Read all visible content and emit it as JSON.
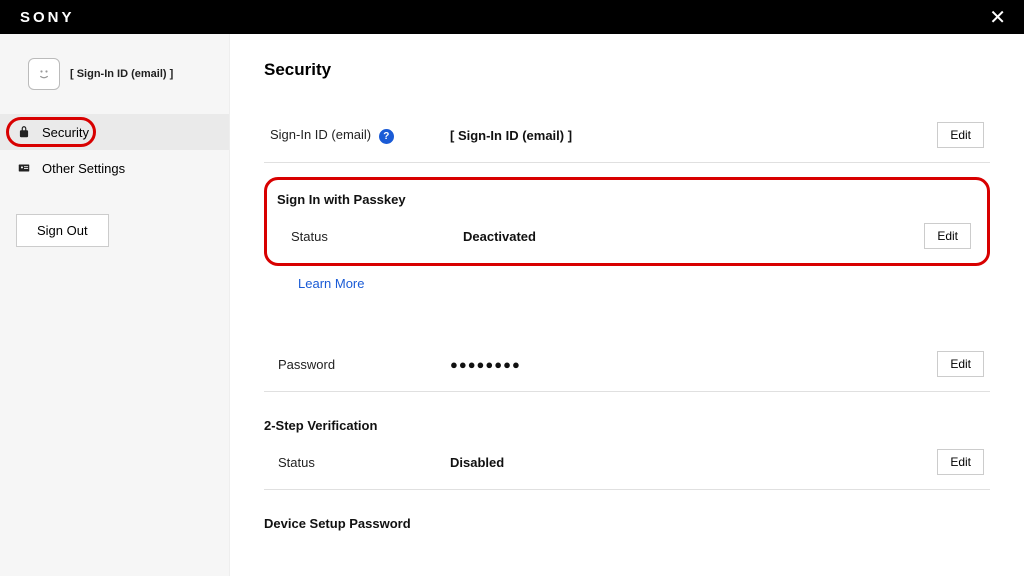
{
  "header": {
    "brand": "SONY"
  },
  "sidebar": {
    "profile_label": "[ Sign-In ID (email) ]",
    "items": [
      {
        "label": "Security",
        "active": true
      },
      {
        "label": "Other Settings",
        "active": false
      }
    ],
    "signout_label": "Sign Out"
  },
  "main": {
    "title": "Security",
    "signin_id": {
      "label": "Sign-In ID (email)",
      "value": "[ Sign-In ID (email) ]",
      "edit": "Edit"
    },
    "passkey": {
      "section": "Sign In with Passkey",
      "status_label": "Status",
      "status_value": "Deactivated",
      "edit": "Edit",
      "learn_more": "Learn More"
    },
    "password": {
      "label": "Password",
      "value": "●●●●●●●●",
      "edit": "Edit"
    },
    "twostep": {
      "section": "2-Step Verification",
      "status_label": "Status",
      "status_value": "Disabled",
      "edit": "Edit"
    },
    "device_setup": {
      "section": "Device Setup Password"
    }
  }
}
